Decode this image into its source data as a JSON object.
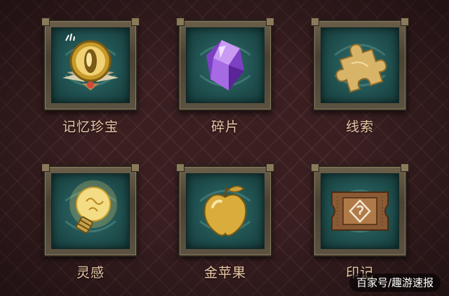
{
  "items": [
    {
      "label": "记忆珍宝",
      "icon": "memory-treasure-icon",
      "color": "#d9b24a"
    },
    {
      "label": "碎片",
      "icon": "crystal-fragment-icon",
      "color": "#9b62e0"
    },
    {
      "label": "线索",
      "icon": "puzzle-piece-icon",
      "color": "#d8b468"
    },
    {
      "label": "灵感",
      "icon": "lightbulb-icon",
      "color": "#f2d779"
    },
    {
      "label": "金苹果",
      "icon": "golden-apple-icon",
      "color": "#e0b84a"
    },
    {
      "label": "印记",
      "icon": "ticket-stamp-icon",
      "color": "#8a5a34"
    }
  ],
  "watermark": "百家号/趣游速报",
  "colors": {
    "background": "#3a1f21",
    "label": "#e8c7a6",
    "panel": "#1f4f4e",
    "frame": "#5c5242"
  }
}
